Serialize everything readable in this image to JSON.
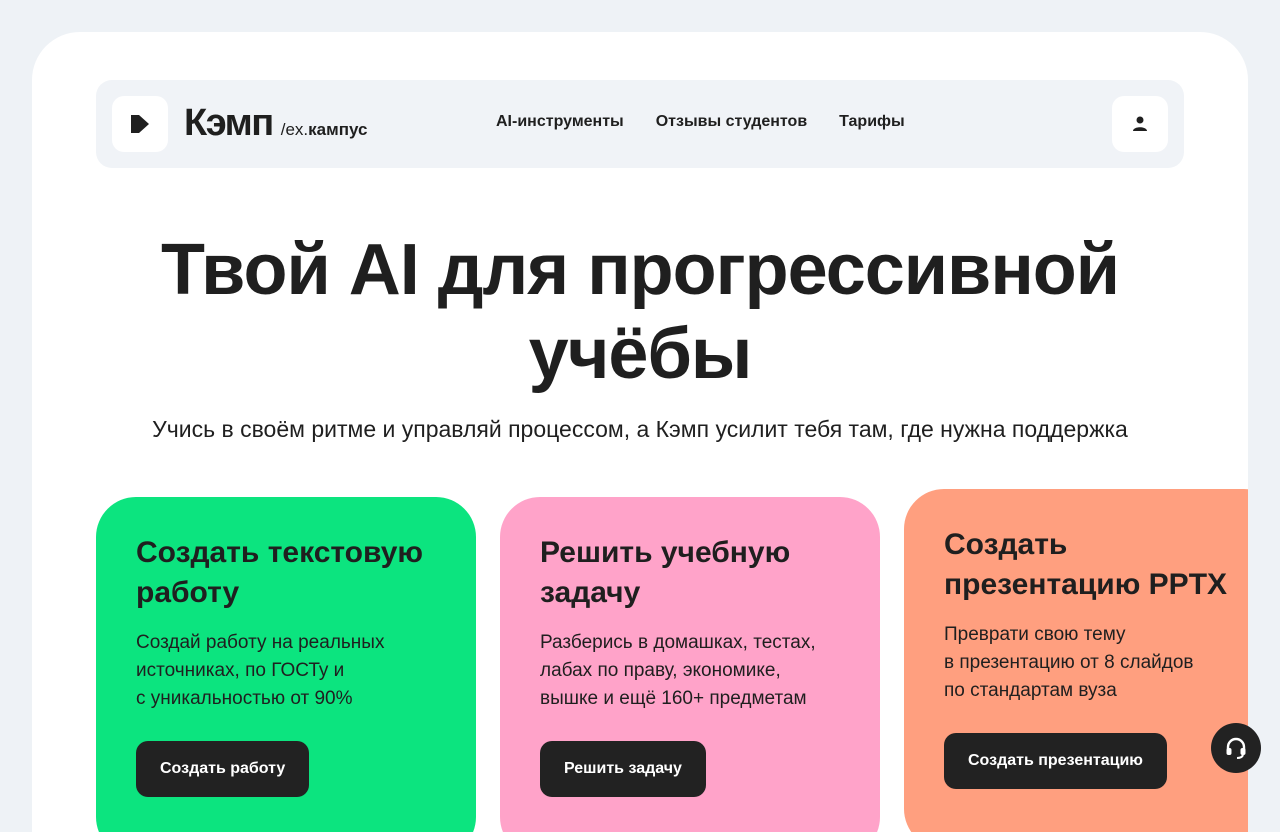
{
  "header": {
    "brand_name": "Кэмп",
    "brand_ex_prefix": "/ex.",
    "brand_ex_name": "кампус",
    "nav": [
      {
        "label": "AI-инструменты"
      },
      {
        "label": "Отзывы студентов"
      },
      {
        "label": "Тарифы"
      }
    ],
    "user_icon": "user-icon"
  },
  "hero": {
    "title_line1": "Твой AI для прогрессивной",
    "title_line2": "учёбы",
    "subtitle": "Учись в своём ритме и управляй процессом, а Кэмп усилит тебя там, где нужна поддержка"
  },
  "cards": [
    {
      "title": "Создать текстовую работу",
      "description": "Создай работу на реальных\nисточниках, по ГОСТу и\nс уникальностью от 90%",
      "button": "Создать работу",
      "color": "#0ce47f"
    },
    {
      "title": "Решить учебную задачу",
      "description": "Разберись в домашках, тестах,\nлабах по праву, экономике,\nвышке и ещё 160+ предметам",
      "button": "Решить задачу",
      "color": "#ffa3c9"
    },
    {
      "title": "Создать презентацию PPTX",
      "description": "Преврати свою тему\nв презентацию от 8 слайдов\nпо стандартам вуза",
      "button": "Создать презентацию",
      "color": "#ff9f7f"
    }
  ],
  "support": {
    "icon": "headset-icon"
  },
  "colors": {
    "page_bg": "#eef2f6",
    "panel_bg": "#ffffff",
    "header_bg": "#f0f3f7",
    "dark": "#222222"
  }
}
